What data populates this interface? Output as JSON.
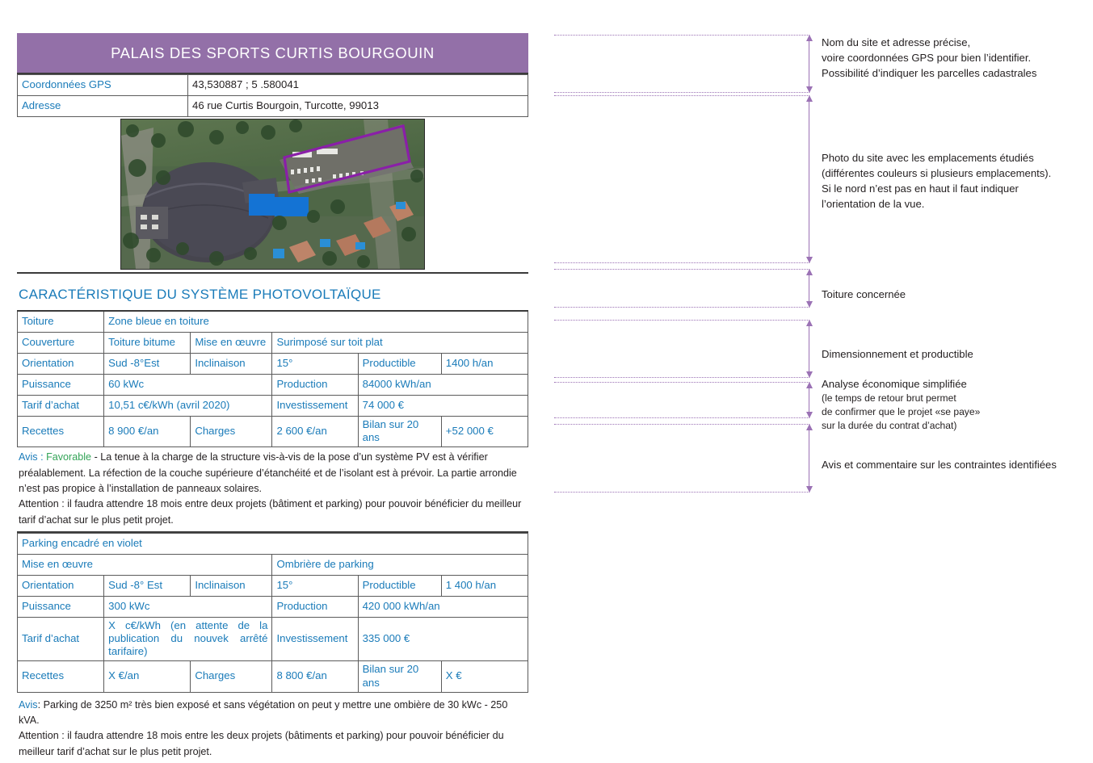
{
  "document": {
    "site_title": "PALAIS DES SPORTS CURTIS BOURGOUIN",
    "identity_rows": [
      {
        "label": "Coordonnées GPS",
        "value": "43,530887 ; 5 .580041"
      },
      {
        "label": "Adresse",
        "value": "46 rue Curtis Bourgoin, Turcotte, 99013"
      }
    ],
    "photo_alt": "Vue aérienne du Palais des Sports avec parking encadré en violet",
    "section_heading": "CARACTÉRISTIQUE DU SYSTÈME PHOTOVOLTAÏQUE",
    "roof_table": {
      "zone_label": "Toiture",
      "zone_value": "Zone bleue en toiture",
      "rows": [
        {
          "c1": "Couverture",
          "c2": "Toiture bitume",
          "c3": "Mise en œuvre",
          "c4": "Surimposé sur toit plat",
          "c5": "",
          "c6": ""
        },
        {
          "c1": "Orientation",
          "c2": "Sud -8°Est",
          "c3": "Inclinaison",
          "c4": "15°",
          "c5": "Productible",
          "c6": "1400 h/an"
        },
        {
          "c1": "Puissance",
          "c2": "60 kWc",
          "c3": "",
          "c4": "Production",
          "c5": "84000 kWh/an",
          "c6": ""
        },
        {
          "c1": "Tarif d’achat",
          "c2": "10,51 c€/kWh (avril 2020)",
          "c3": "",
          "c4": "Investissement",
          "c5": "74 000 €",
          "c6": ""
        },
        {
          "c1": "Recettes",
          "c2": "8 900 €/an",
          "c3": "Charges",
          "c4": "2 600 €/an",
          "c5": "Bilan sur 20 ans",
          "c6": "+52 000 €"
        }
      ]
    },
    "roof_note": {
      "avis_label": "Avis :",
      "avis_value": "Favorable",
      "body": "- La tenue à la charge de la structure vis-à-vis de la pose d’un système PV est à vérifier préalablement. La réfection de la couche supérieure d’étanchéité et de l’isolant est à prévoir. La partie arrondie n’est pas propice à l’installation de panneaux solaires.",
      "attention": "Attention : il faudra attendre 18 mois entre deux projets (bâtiment et parking) pour pouvoir bénéficier du meilleur tarif d’achat sur le plus petit projet."
    },
    "parking_table": {
      "zone_value": "Parking encadré en violet",
      "mise_label": "Mise en œuvre",
      "mise_value": "Ombrière de parking",
      "rows": [
        {
          "c1": "Orientation",
          "c2": "Sud -8° Est",
          "c3": "Inclinaison",
          "c4": "15°",
          "c5": "Productible",
          "c6": "1 400 h/an"
        },
        {
          "c1": "Puissance",
          "c2": "300 kWc",
          "c3": "",
          "c4": "Production",
          "c5": "420 000 kWh/an",
          "c6": ""
        },
        {
          "c1": "Tarif d’achat",
          "c2": "X c€/kWh (en attente de la publication du nouvek arrêté tarifaire)",
          "c3": "",
          "c4": "Investissement",
          "c5": "335 000 €",
          "c6": ""
        },
        {
          "c1": "Recettes",
          "c2": "X €/an",
          "c3": "Charges",
          "c4": "8 800 €/an",
          "c5": "Bilan sur 20 ans",
          "c6": "X €"
        }
      ]
    },
    "parking_note": {
      "avis_label": "Avis",
      "body": ": Parking de 3250 m² très  bien exposé et sans végétation on peut y mettre une ombière de 30 kWc - 250 kVA.",
      "attention": "Attention : il faudra attendre 18 mois entre les deux projets (bâtiments et parking) pour pouvoir bénéficier du meilleur tarif d’achat sur le plus petit projet."
    }
  },
  "annotations": [
    {
      "id": "identite",
      "text": "Nom du site et adresse précise,\nvoire coordonnées GPS pour bien l’identifier.\nPossibilité d’indiquer les parcelles cadastrales"
    },
    {
      "id": "photo",
      "text": "Photo du site avec les emplacements étudiés\n(différentes couleurs si plusieurs emplacements).\nSi le nord n’est pas en haut il faut indiquer\nl’orientation de la vue."
    },
    {
      "id": "toiture",
      "text": "Toiture concernée"
    },
    {
      "id": "dimension",
      "text": "Dimensionnement et productible"
    },
    {
      "id": "economie",
      "title": "Analyse économique simplifiée",
      "text": "(le temps de retour brut permet\nde confirmer que le projet «se paye»\nsur la durée du contrat d’achat)"
    },
    {
      "id": "avis",
      "text": "Avis et commentaire sur les contraintes identifiées"
    }
  ],
  "colors": {
    "header_purple": "#9370a8",
    "accent_blue": "#1a7bb9",
    "favorable_green": "#33a457",
    "annotation_purple": "#9b72b5",
    "parking_outline": "#8a1fa8"
  }
}
